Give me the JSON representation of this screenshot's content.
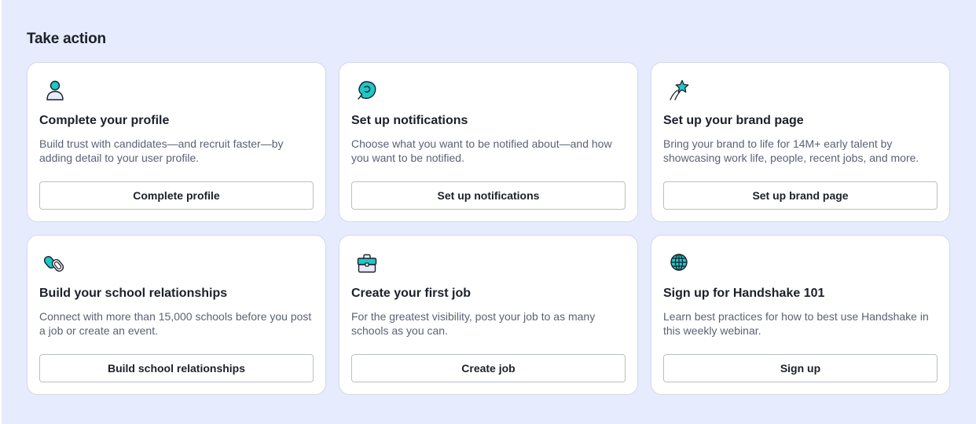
{
  "section": {
    "title": "Take action"
  },
  "colors": {
    "page_background": "#e7ebfe",
    "card_background": "#ffffff",
    "icon_accent": "#1fc7c7",
    "icon_stroke": "#1c2029"
  },
  "cards": [
    {
      "icon": "person-icon",
      "title": "Complete your profile",
      "description": "Build trust with candidates—and recruit faster—by adding detail to your user profile.",
      "button_label": "Complete profile"
    },
    {
      "icon": "notification-swirl-icon",
      "title": "Set up notifications",
      "description": "Choose what you want to be notified about—and how you want to be notified.",
      "button_label": "Set up notifications"
    },
    {
      "icon": "shooting-star-icon",
      "title": "Set up your brand page",
      "description": "Bring your brand to life for 14M+ early talent by showcasing work life, people, recent jobs, and more.",
      "button_label": "Set up brand page"
    },
    {
      "icon": "chain-link-icon",
      "title": "Build your school relationships",
      "description": "Connect with more than 15,000 schools before you post a job or create an event.",
      "button_label": "Build school relationships"
    },
    {
      "icon": "briefcase-icon",
      "title": "Create your first job",
      "description": "For the greatest visibility, post your job to as many schools as you can.",
      "button_label": "Create job"
    },
    {
      "icon": "globe-icon",
      "title": "Sign up for Handshake 101",
      "description": "Learn best practices for how to best use Handshake in this weekly webinar.",
      "button_label": "Sign up"
    }
  ]
}
